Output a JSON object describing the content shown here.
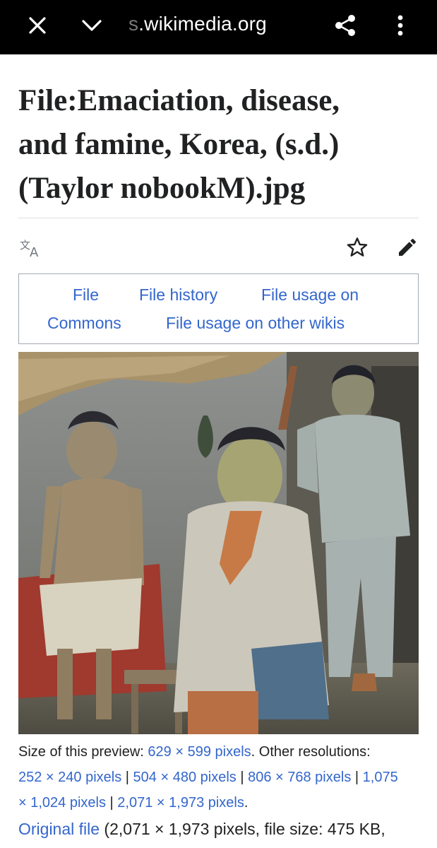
{
  "browser": {
    "url_faded": "s",
    "url_text": ".wikimedia.org",
    "icons": [
      "close-icon",
      "chevron-down-icon",
      "share-icon",
      "more-vertical-icon"
    ]
  },
  "page": {
    "title_line1": "File:Emaciation, disease,",
    "title_line2": "and famine, Korea, (s.d.)",
    "title_line3": "(Taylor nobookM).jpg",
    "actions": [
      "translate-icon",
      "star-icon",
      "edit-pencil-icon"
    ]
  },
  "tabs": {
    "file": "File",
    "history": "File history",
    "usage": "File usage on",
    "commons": "Commons",
    "other_wikis": "File usage on other wikis"
  },
  "image": {
    "caption": ""
  },
  "info": {
    "preview_prefix": "Size of this preview: ",
    "preview_link": "629 × 599 pixels",
    "preview_suffix": ". Other resolutions:",
    "res1": "252 × 240 pixels",
    "res2": "504 × 480 pixels",
    "res3": "806 × 768 pixels",
    "res4a": "1,075",
    "res4b": "× 1,024 pixels",
    "res5": "2,071 × 1,973 pixels",
    "sep": " | ",
    "end": ".",
    "original_link": "Original file",
    "original_rest": " (2,071 × 1,973 pixels, file size: 475 KB,"
  },
  "colors": {
    "link": "#3366cc",
    "text": "#202122",
    "border": "#a2a9b1",
    "topbar": "#000000"
  }
}
